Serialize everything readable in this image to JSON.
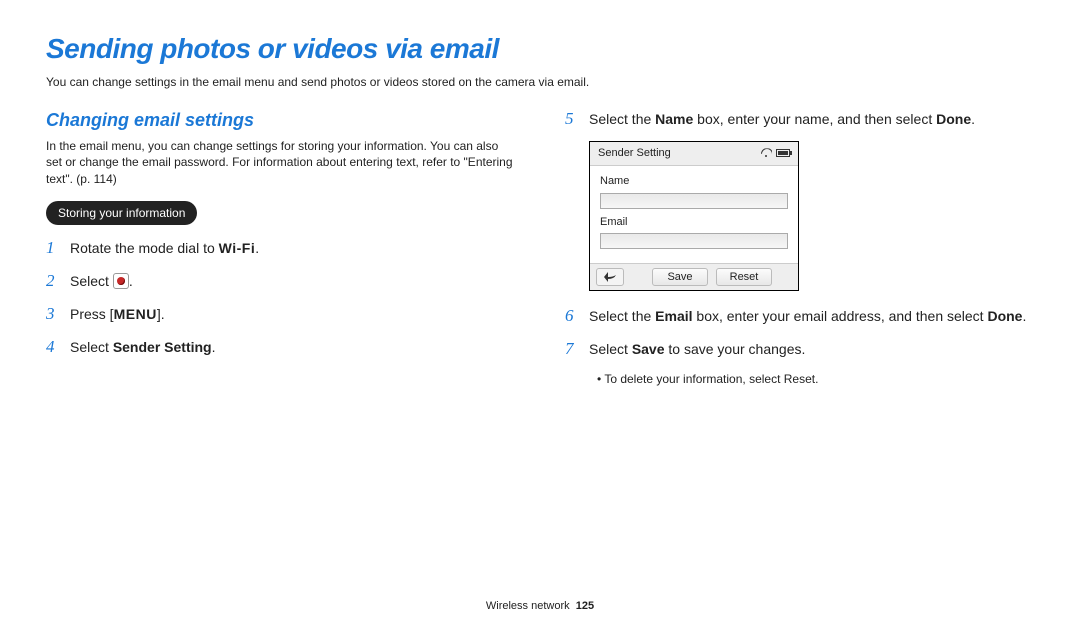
{
  "title": "Sending photos or videos via email",
  "intro": "You can change settings in the email menu and send photos or videos stored on the camera via email.",
  "section": {
    "heading": "Changing email settings",
    "intro": "In the email menu, you can change settings for storing your information. You can also set or change the email password. For information about entering text, refer to \"Entering text\". (p. 114)"
  },
  "pill": "Storing your information",
  "left_steps": {
    "s1": {
      "num": "1",
      "prefix": "Rotate the mode dial to ",
      "inline": "Wi-Fi",
      "suffix": "."
    },
    "s2": {
      "num": "2",
      "prefix": "Select ",
      "suffix": "."
    },
    "s3": {
      "num": "3",
      "prefix": "Press [",
      "inline": "MENU",
      "suffix": "]."
    },
    "s4": {
      "num": "4",
      "prefix": "Select ",
      "bold": "Sender Setting",
      "suffix": "."
    }
  },
  "right_steps": {
    "s5": {
      "num": "5",
      "p1": "Select the ",
      "b1": "Name",
      "p2": " box, enter your name, and then select ",
      "b2": "Done",
      "p3": "."
    },
    "s6": {
      "num": "6",
      "p1": "Select the ",
      "b1": "Email",
      "p2": " box, enter your email address, and then select ",
      "b2": "Done",
      "p3": "."
    },
    "s7": {
      "num": "7",
      "p1": "Select ",
      "b1": "Save",
      "p2": " to save your changes."
    }
  },
  "shot": {
    "title": "Sender Setting",
    "name_label": "Name",
    "email_label": "Email",
    "save": "Save",
    "reset": "Reset"
  },
  "note": "To delete your information, select Reset.",
  "footer": {
    "section": "Wireless network",
    "page": "125"
  }
}
